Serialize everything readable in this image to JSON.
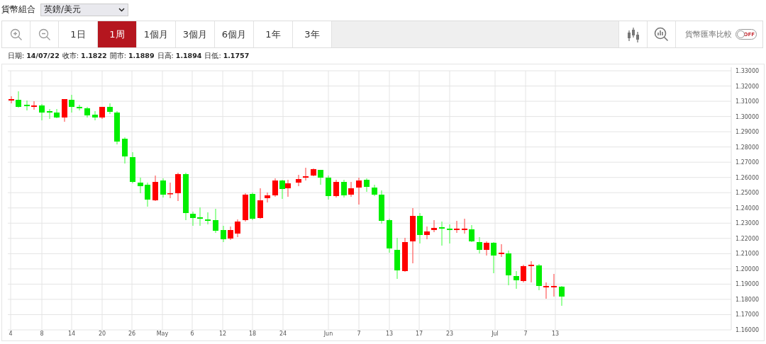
{
  "currency_pair": {
    "label": "貨幣組合",
    "value": "英鎊/美元"
  },
  "toolbar": {
    "tabs": [
      {
        "label": "1日",
        "selected": false
      },
      {
        "label": "1周",
        "selected": true
      },
      {
        "label": "1個月",
        "selected": false
      },
      {
        "label": "3個月",
        "selected": false
      },
      {
        "label": "6個月",
        "selected": false
      },
      {
        "label": "1年",
        "selected": false
      },
      {
        "label": "3年",
        "selected": false
      }
    ],
    "compare": {
      "label": "貨幣匯率比較",
      "switch_text": "OFF",
      "on": false
    }
  },
  "quote": [
    {
      "label": "日期:",
      "value": "14/07/22"
    },
    {
      "label": "收市:",
      "value": "1.1822"
    },
    {
      "label": "開市:",
      "value": "1.1889"
    },
    {
      "label": "日高:",
      "value": "1.1894"
    },
    {
      "label": "日低:",
      "value": "1.1757"
    }
  ],
  "chart": {
    "y_labels": [
      "1.33000",
      "1.32000",
      "1.31000",
      "1.30000",
      "1.29000",
      "1.28000",
      "1.27000",
      "1.26000",
      "1.25000",
      "1.24000",
      "1.23000",
      "1.22000",
      "1.21000",
      "1.20000",
      "1.19000",
      "1.18000",
      "1.17000",
      "1.16000"
    ],
    "x_labels": [
      "4",
      "8",
      "14",
      "20",
      "26",
      "May",
      "6",
      "12",
      "18",
      "24",
      "Jun",
      "7",
      "13",
      "17",
      "23",
      "Jul",
      "7",
      "13"
    ]
  }
}
